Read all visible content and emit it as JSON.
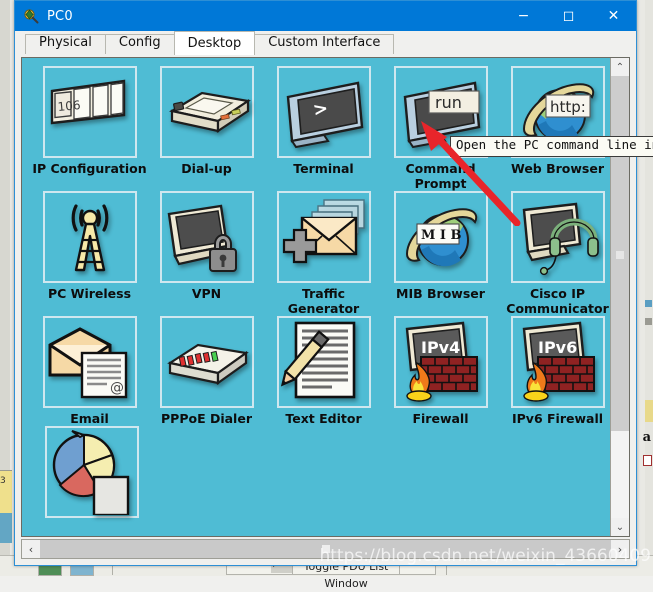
{
  "background_app": {
    "bottom_bar": {
      "toggle_pdu_label": "Toggle PDU List Window",
      "arrow_label": "›",
      "left_arrow_label": "‹"
    },
    "side_label": "a",
    "small_number": "3"
  },
  "window": {
    "title": "PC0",
    "icon": "packet-tracer-icon",
    "controls": {
      "minimize": "−",
      "maximize": "◻",
      "close": "✕"
    }
  },
  "tabs": [
    {
      "label": "Physical",
      "active": false
    },
    {
      "label": "Config",
      "active": false
    },
    {
      "label": "Desktop",
      "active": true
    },
    {
      "label": "Custom Interface",
      "active": false
    }
  ],
  "desktop": {
    "background_color": "#4fbcd4",
    "items": [
      {
        "label": "IP Configuration",
        "icon": "ip-configuration-icon",
        "badge": "106"
      },
      {
        "label": "Dial-up",
        "icon": "dial-up-modem-icon",
        "badge": ""
      },
      {
        "label": "Terminal",
        "icon": "terminal-icon",
        "badge": ">"
      },
      {
        "label": "Command Prompt",
        "icon": "command-prompt-icon",
        "badge": "run"
      },
      {
        "label": "Web Browser",
        "icon": "web-browser-icon",
        "badge": "http:"
      },
      {
        "label": "PC Wireless",
        "icon": "pc-wireless-antenna-icon",
        "badge": ""
      },
      {
        "label": "VPN",
        "icon": "vpn-lock-icon",
        "badge": ""
      },
      {
        "label": "Traffic Generator",
        "icon": "traffic-generator-icon",
        "badge": ""
      },
      {
        "label": "MIB Browser",
        "icon": "mib-browser-icon",
        "badge": "M I B"
      },
      {
        "label": "Cisco IP Communicator",
        "icon": "ip-communicator-icon",
        "badge": ""
      },
      {
        "label": "Email",
        "icon": "email-icon",
        "badge": "@"
      },
      {
        "label": "PPPoE Dialer",
        "icon": "pppoe-dialer-icon",
        "badge": ""
      },
      {
        "label": "Text Editor",
        "icon": "text-editor-icon",
        "badge": ""
      },
      {
        "label": "Firewall",
        "icon": "firewall-icon",
        "badge": "IPv4"
      },
      {
        "label": "IPv6 Firewall",
        "icon": "ipv6-firewall-icon",
        "badge": "IPv6"
      },
      {
        "label": "",
        "icon": "pie-chart-report-icon",
        "badge": ""
      }
    ]
  },
  "tooltip": {
    "text": "Open the PC command line interf",
    "target": "command-prompt-icon"
  },
  "annotation": {
    "type": "red-arrow",
    "color": "#e8252a",
    "points_to": "command-prompt-icon"
  },
  "watermark": {
    "text": "https://blog.csdn.net/weixin_43660409"
  },
  "scrollbars": {
    "vertical": {
      "up": "⌃",
      "down": "⌄"
    },
    "horizontal": {
      "left": "‹",
      "right": "›"
    }
  }
}
